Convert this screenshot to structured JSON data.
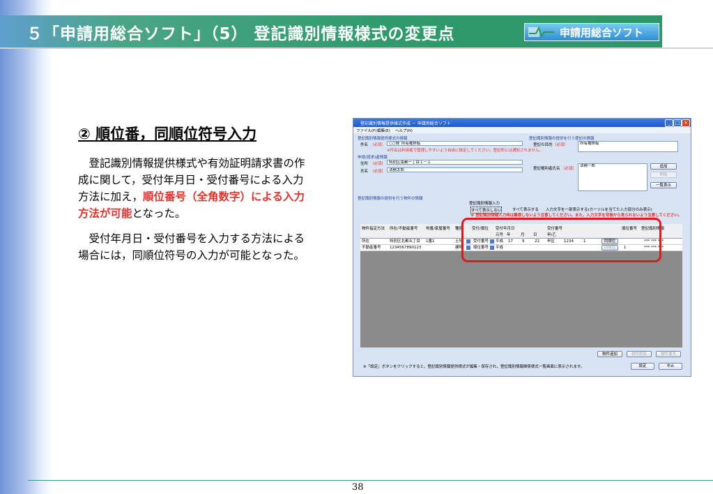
{
  "slide": {
    "title": "５「申請用総合ソフト」（5） 登記識別情報様式の変更点",
    "logo_text": "申請用総合ソフト",
    "subheading": "② 順位番，同順位符号入力",
    "para1_a": "　登記識別情報提供様式や有効証明請求書の作成に関して，受付年月日・受付番号による入力方法に加え，",
    "para1_red": "順位番号（全角数字）による入力方法が可能",
    "para1_b": "となった。",
    "para2": "　受付年月日・受付番号を入力する方法による場合には，同順位符号の入力が可能となった。",
    "page_number": "38"
  },
  "app": {
    "window_title": "登記識別情報提供様式作成 － 申請用総合ソフト",
    "menu": [
      "ファイル(F)",
      "編集(E)",
      "ヘルプ(H)"
    ],
    "group_form": "登記識別情報提供様式の情報",
    "subject_label": "件名",
    "required": "（必須）",
    "subject_value": "○○様_所有権移転",
    "subject_note": "※件名は利用者で管理しやすいよう自由に設定してください。登記所には通知されません。",
    "group_applicant": "申請(請求)者情報",
    "address_label": "住所",
    "address_value": "特別区南都一丁目１－１",
    "name_label": "氏名",
    "name_value": "法務太郎",
    "group_registration": "登記識別情報の提供を行う登記の情報",
    "purpose_label": "登記の目的",
    "purpose_value": "所有権移転",
    "holder_label": "登記権利者氏名",
    "holder_value": "法務一郎",
    "btn_add": "追加",
    "btn_delete": "削除",
    "btn_list": "一覧表示",
    "group_property": "登記識別情報の提供を行う物件の情報",
    "input_label": "登記識別情報入力",
    "radio_all_hidden": "すべて表示しない",
    "radio_all_show": "すべて表示する",
    "radio_partial": "入力文字を一部表示する(カーソルを当てた入力部分のみ表示)",
    "warning": "※ 登記識別情報入力時は離席しないよう注意してください。また，入力文字を背後から見られないよう注意してください。",
    "columns": [
      "物件指定方法",
      "所在/不動産番号",
      "地番/家屋番号",
      "種別",
      "受付/順位",
      "受付年月日",
      "受付番号",
      "順位番号",
      "登記識別情報"
    ],
    "subcolumns": [
      "元号",
      "年",
      "月",
      "日",
      "甲/乙"
    ],
    "rows": [
      {
        "method": "所在",
        "location": "特別区北都五丁目",
        "lot": "1番1",
        "kind": "土地",
        "type": "受付番号",
        "era": "平成",
        "year": "17",
        "month": "9",
        "day": "22",
        "kou": "甲区",
        "num": "1234",
        "rank": "",
        "sub": "1",
        "code": "***  ***  ***"
      },
      {
        "method": "不動産番号",
        "location": "1234567890123",
        "lot": "",
        "kind": "建物",
        "type": "順位番号",
        "era": "平成",
        "year": "",
        "month": "",
        "day": "",
        "kou": "",
        "num": "",
        "rank": "1",
        "sub": "",
        "code": "***  ***  ***"
      }
    ],
    "btn_same_rank": "同順位",
    "btn_add_property": "物件追加",
    "btn_delete_property": "物件削除",
    "btn_copy_property": "物件複写",
    "bottom_note": "※「設定」ボタンをクリックすると，登記識別情報提供様式が編集・保存され，登記識別情報関係様式一覧画面に表示されます。",
    "btn_set": "設定",
    "btn_cancel": "中止"
  },
  "colors": {
    "header": "#2f9a6c",
    "accent_red": "#e8302a",
    "highlight": "#e01a1a"
  }
}
